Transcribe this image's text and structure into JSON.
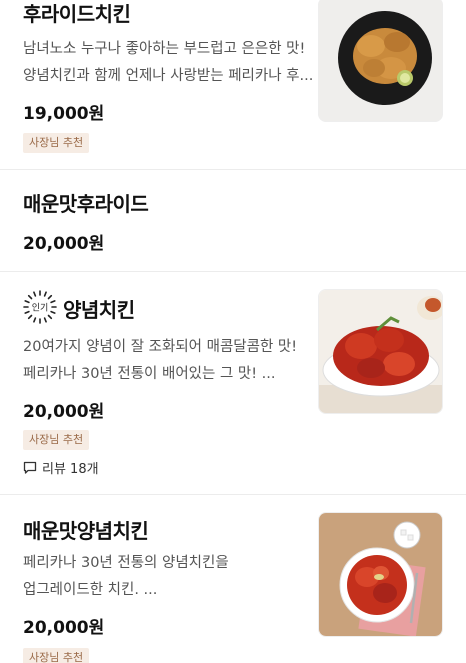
{
  "menu": [
    {
      "name": "후라이드치킨",
      "desc_line1": "남녀노소 누구나 좋아하는 부드럽고 은은한 맛!",
      "desc_line2": "양념치킨과 함께 언제나 사랑받는 페리카나 후...",
      "price": "19,000원",
      "badge": "사장님 추천"
    },
    {
      "name": "매운맛후라이드",
      "price": "20,000원"
    },
    {
      "name": "양념치킨",
      "popular_label": "인기",
      "desc_line1": "20여가지 양념이 잘 조화되어 매콤달콤한 맛!",
      "desc_line2": "페리카나 30년 전통이 배어있는 그 맛!  ...",
      "price": "20,000원",
      "badge": "사장님 추천",
      "review": "리뷰 18개"
    },
    {
      "name": "매운맛양념치킨",
      "desc_line1": "페리카나 30년 전통의 양념치킨을",
      "desc_line2": "업그레이드한 치킨.  ...",
      "price": "20,000원",
      "badge": "사장님 추천"
    }
  ],
  "colors": {
    "badge_bg": "#f6ece4",
    "badge_text": "#9a6a48",
    "divider": "#ececec"
  }
}
